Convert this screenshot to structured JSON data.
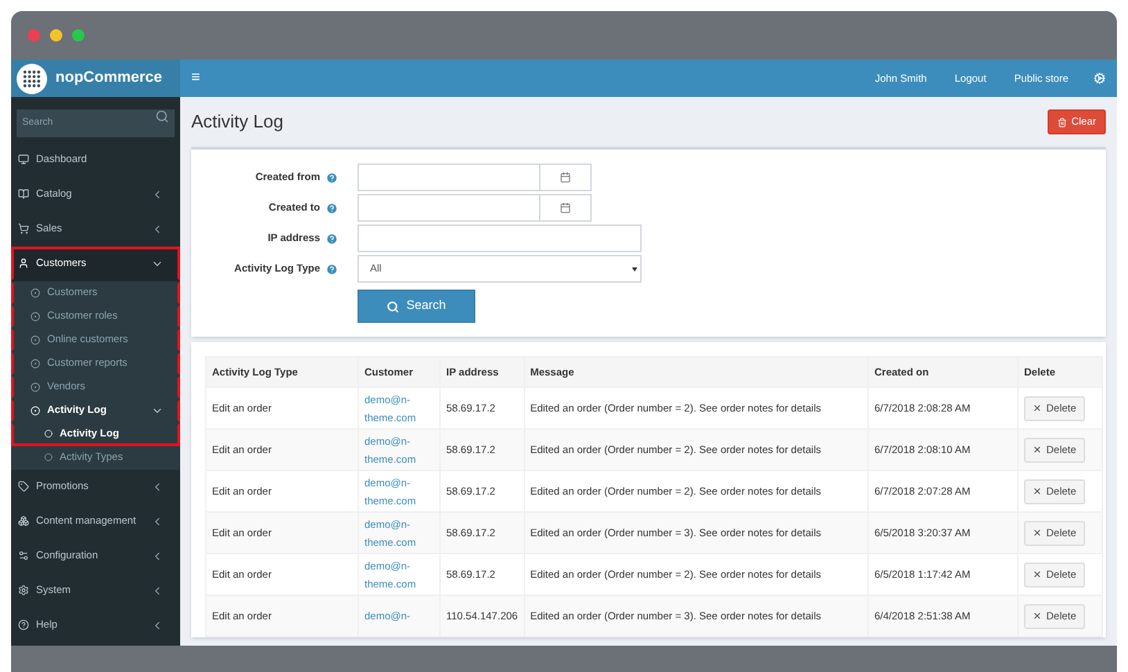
{
  "header": {
    "logo_text": "nopCommerce",
    "menu_icon": "≡",
    "links": [
      "John Smith",
      "Logout",
      "Public store"
    ]
  },
  "sidebar": {
    "search": {
      "placeholder": "Search"
    },
    "items": [
      {
        "label": "Dashboard",
        "selected": false,
        "highlighted": false
      },
      {
        "label": "Catalog",
        "expanded": false,
        "selected": false,
        "highlighted": false
      },
      {
        "label": "Sales",
        "expanded": false,
        "selected": false,
        "highlighted": false
      },
      {
        "label": "Customers",
        "expanded": true,
        "selected": true,
        "highlighted": true,
        "children": [
          {
            "label": "Customers",
            "selected": false,
            "highlighted": true
          },
          {
            "label": "Customer roles",
            "selected": false,
            "highlighted": true
          },
          {
            "label": "Online customers",
            "selected": false,
            "highlighted": true
          },
          {
            "label": "Customer reports",
            "selected": false,
            "highlighted": true
          },
          {
            "label": "Vendors",
            "selected": false,
            "highlighted": true
          },
          {
            "label": "Activity Log",
            "expanded": true,
            "selected": true,
            "highlighted": true,
            "children": [
              {
                "label": "Activity Log",
                "selected": true,
                "highlighted": true
              },
              {
                "label": "Activity Types",
                "selected": false,
                "highlighted": false
              }
            ]
          }
        ]
      },
      {
        "label": "Promotions",
        "expanded": false,
        "selected": false,
        "highlighted": false
      },
      {
        "label": "Content management",
        "expanded": false,
        "selected": false,
        "highlighted": false
      },
      {
        "label": "Configuration",
        "expanded": false,
        "selected": false,
        "highlighted": false
      },
      {
        "label": "System",
        "expanded": false,
        "selected": false,
        "highlighted": false
      },
      {
        "label": "Help",
        "expanded": false,
        "selected": false,
        "highlighted": false
      }
    ]
  },
  "page": {
    "title": "Activity Log",
    "clear_button": "Clear"
  },
  "filters": {
    "fields": [
      {
        "label": "Created from",
        "kind": "date"
      },
      {
        "label": "Created to",
        "kind": "date"
      },
      {
        "label": "IP address",
        "kind": "text"
      },
      {
        "label": "Activity Log Type",
        "kind": "select",
        "value": "All"
      }
    ],
    "search_button": "Search"
  },
  "table": {
    "columns": [
      "Activity Log Type",
      "Customer",
      "IP address",
      "Message",
      "Created on",
      "Delete"
    ],
    "rows": [
      {
        "type": "Edit an order",
        "customer": "demo@n-theme.com",
        "ip": "58.69.17.2",
        "message": "Edited an order (Order number = 2). See order notes for details",
        "created_on": "6/7/2018 2:08:28 AM",
        "action": "Delete"
      },
      {
        "type": "Edit an order",
        "customer": "demo@n-theme.com",
        "ip": "58.69.17.2",
        "message": "Edited an order (Order number = 2). See order notes for details",
        "created_on": "6/7/2018 2:08:10 AM",
        "action": "Delete"
      },
      {
        "type": "Edit an order",
        "customer": "demo@n-theme.com",
        "ip": "58.69.17.2",
        "message": "Edited an order (Order number = 2). See order notes for details",
        "created_on": "6/7/2018 2:07:28 AM",
        "action": "Delete"
      },
      {
        "type": "Edit an order",
        "customer": "demo@n-theme.com",
        "ip": "58.69.17.2",
        "message": "Edited an order (Order number = 3). See order notes for details",
        "created_on": "6/5/2018 3:20:37 AM",
        "action": "Delete"
      },
      {
        "type": "Edit an order",
        "customer": "demo@n-theme.com",
        "ip": "58.69.17.2",
        "message": "Edited an order (Order number = 2). See order notes for details",
        "created_on": "6/5/2018 1:17:42 AM",
        "action": "Delete"
      },
      {
        "type": "Edit an order",
        "customer": "demo@n-",
        "ip": "110.54.147.206",
        "message": "Edited an order (Order number = 3). See order notes for details",
        "created_on": "6/4/2018 2:51:38 AM",
        "action": "Delete"
      }
    ]
  }
}
